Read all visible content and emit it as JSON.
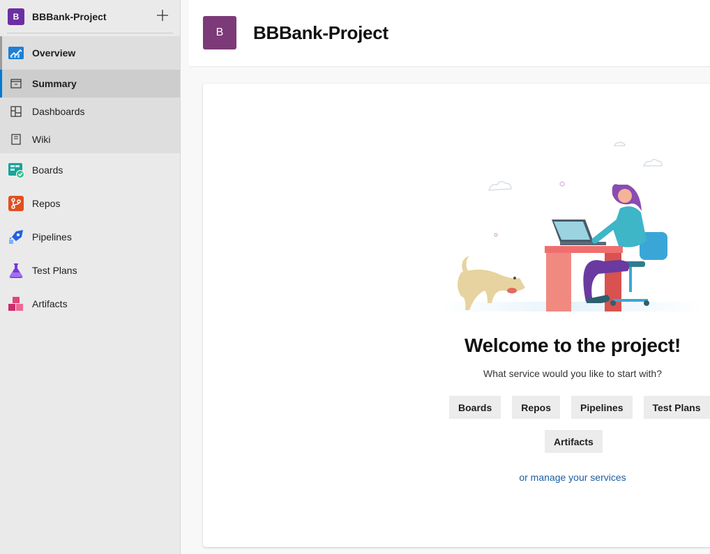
{
  "sidebar": {
    "project_avatar": "B",
    "project_name": "BBBank-Project",
    "overview": {
      "label": "Overview",
      "icon": "overview-icon"
    },
    "sub_items": [
      {
        "label": "Summary",
        "icon": "summary-icon",
        "selected": true
      },
      {
        "label": "Dashboards",
        "icon": "dashboards-icon"
      },
      {
        "label": "Wiki",
        "icon": "wiki-icon"
      }
    ],
    "items": [
      {
        "label": "Boards",
        "icon": "boards-icon",
        "color": "#009ccc"
      },
      {
        "label": "Repos",
        "icon": "repos-icon",
        "color": "#e05a2b"
      },
      {
        "label": "Pipelines",
        "icon": "pipelines-icon",
        "color": "#2560e0"
      },
      {
        "label": "Test Plans",
        "icon": "test-plans-icon",
        "color": "#773adc"
      },
      {
        "label": "Artifacts",
        "icon": "artifacts-icon",
        "color": "#cb2e6d"
      }
    ]
  },
  "header": {
    "avatar": "B",
    "title": "BBBank-Project"
  },
  "welcome": {
    "title": "Welcome to the project!",
    "subtitle": "What service would you like to start with?",
    "services": [
      "Boards",
      "Repos",
      "Pipelines",
      "Test Plans",
      "Artifacts"
    ],
    "manage_link": "or manage your services"
  },
  "colors": {
    "accent": "#0078d4",
    "project_purple": "#7d3a78",
    "link": "#1b5ea4"
  }
}
